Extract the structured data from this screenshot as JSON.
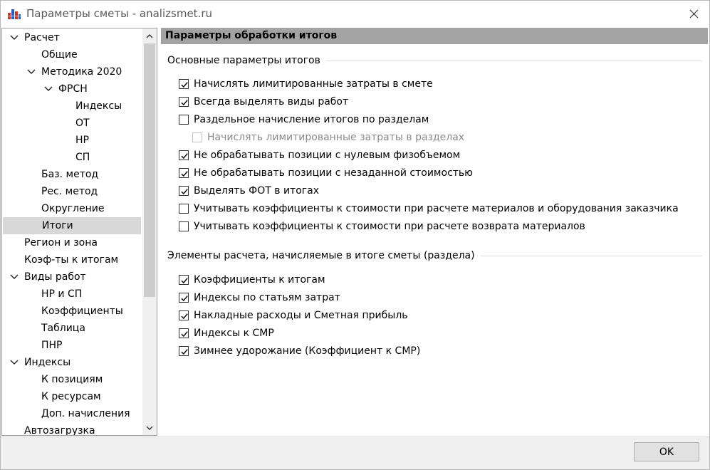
{
  "window": {
    "title": "Параметры сметы - analizsmet.ru",
    "close_icon": "close-icon",
    "app_icon": "bar-chart-app-icon"
  },
  "tree": {
    "items": [
      {
        "label": "Расчет",
        "level": 0,
        "expanded": true
      },
      {
        "label": "Общие",
        "level": 1
      },
      {
        "label": "Методика 2020",
        "level": 1,
        "expanded": true
      },
      {
        "label": "ФРСН",
        "level": 2,
        "expanded": true
      },
      {
        "label": "Индексы",
        "level": 3
      },
      {
        "label": "ОТ",
        "level": 3
      },
      {
        "label": "НР",
        "level": 3
      },
      {
        "label": "СП",
        "level": 3
      },
      {
        "label": "Баз. метод",
        "level": 1
      },
      {
        "label": "Рес. метод",
        "level": 1
      },
      {
        "label": "Округление",
        "level": 1
      },
      {
        "label": "Итоги",
        "level": 1,
        "selected": true
      },
      {
        "label": "Регион и зона",
        "level": 0
      },
      {
        "label": "Коэф-ты к итогам",
        "level": 0
      },
      {
        "label": "Виды работ",
        "level": 0,
        "expanded": true
      },
      {
        "label": "НР и СП",
        "level": 1
      },
      {
        "label": "Коэффициенты",
        "level": 1
      },
      {
        "label": "Таблица",
        "level": 1
      },
      {
        "label": "ПНР",
        "level": 1
      },
      {
        "label": "Индексы",
        "level": 0,
        "expanded": true
      },
      {
        "label": "К позициям",
        "level": 1
      },
      {
        "label": "К ресурсам",
        "level": 1
      },
      {
        "label": "Доп. начисления",
        "level": 1
      },
      {
        "label": "Автозагрузка",
        "level": 0
      }
    ]
  },
  "panel": {
    "header": "Параметры обработки итогов",
    "group1": {
      "title": "Основные параметры итогов",
      "options": [
        {
          "label": "Начислять лимитированные затраты в смете",
          "checked": true
        },
        {
          "label": "Всегда выделять виды работ",
          "checked": true
        },
        {
          "label": "Раздельное начисление итогов по разделам",
          "checked": false
        },
        {
          "label": "Начислять лимитированные затраты в разделах",
          "checked": false,
          "disabled": true,
          "sub": true
        },
        {
          "label": "Не обрабатывать позиции с нулевым физобъемом",
          "checked": true
        },
        {
          "label": "Не обрабатывать позиции с незаданной стоимостью",
          "checked": true
        },
        {
          "label": "Выделять ФОТ в итогах",
          "checked": true
        },
        {
          "label": "Учитывать коэффициенты к стоимости при расчете материалов и оборудования заказчика",
          "checked": false
        },
        {
          "label": "Учитывать коэффициенты к стоимости при расчете возврата материалов",
          "checked": false
        }
      ]
    },
    "group2": {
      "title": "Элементы расчета, начисляемые в итоге сметы (раздела)",
      "options": [
        {
          "label": "Коэффициенты к итогам",
          "checked": true
        },
        {
          "label": "Индексы по статьям затрат",
          "checked": true
        },
        {
          "label": "Накладные расходы и Сметная прибыль",
          "checked": true
        },
        {
          "label": "Индексы к СМР",
          "checked": true
        },
        {
          "label": "Зимнее удорожание (Коэффициент к СМР)",
          "checked": true
        }
      ]
    }
  },
  "footer": {
    "ok_label": "OK"
  }
}
